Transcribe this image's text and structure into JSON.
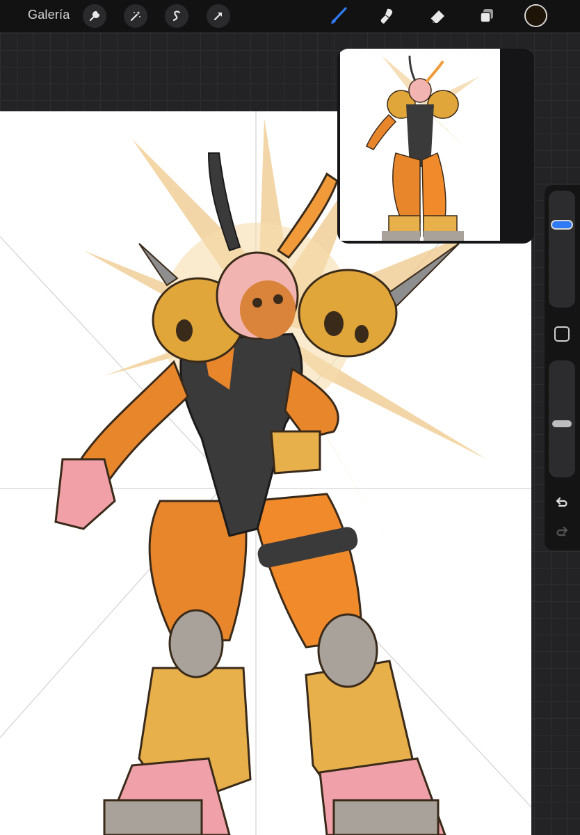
{
  "toolbar": {
    "gallery_label": "Galería",
    "actions_icon": "wrench-icon",
    "adjustments_icon": "magic-wand-icon",
    "selection_icon": "selection-s-icon",
    "transform_icon": "arrow-cursor-icon",
    "brush_icon": "brush-icon",
    "smudge_icon": "smudge-icon",
    "eraser_icon": "eraser-icon",
    "layers_icon": "layers-icon",
    "active_tool": "brush",
    "active_color": "#1e1408"
  },
  "colors": {
    "app_background": "#232325",
    "toolbar_background": "#121213",
    "accent_blue": "#2f7bf5",
    "skin_orange": "#e8862c",
    "armor_gold": "#e0a63a",
    "suit_black": "#3a3a3a",
    "hair_pink": "#f2b4b0"
  },
  "sidebar": {
    "brush_size_level": 0.25,
    "opacity_level": 0.55,
    "modify_icon": "square-modify-icon",
    "undo_icon": "undo-arrow-icon",
    "redo_icon": "redo-arrow-icon"
  },
  "reference_window": {
    "title": ""
  }
}
